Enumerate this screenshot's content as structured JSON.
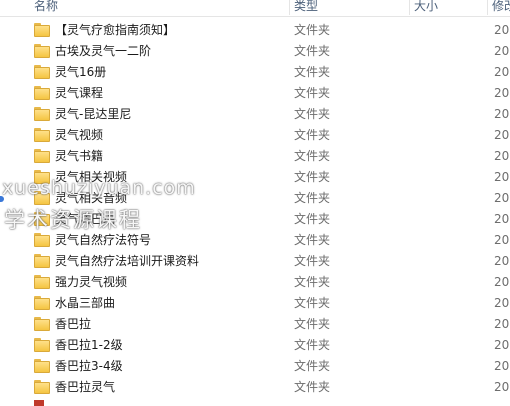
{
  "header": {
    "name": "名称",
    "type": "类型",
    "size": "大小",
    "date": "修改"
  },
  "rows": [
    {
      "name": "【灵气疗愈指南须知】",
      "type": "文件夹",
      "date": "20"
    },
    {
      "name": "古埃及灵气一二阶",
      "type": "文件夹",
      "date": "20"
    },
    {
      "name": "灵气16册",
      "type": "文件夹",
      "date": "20"
    },
    {
      "name": "灵气课程",
      "type": "文件夹",
      "date": "20"
    },
    {
      "name": "灵气-昆达里尼",
      "type": "文件夹",
      "date": "20"
    },
    {
      "name": "灵气视频",
      "type": "文件夹",
      "date": "20"
    },
    {
      "name": "灵气书籍",
      "type": "文件夹",
      "date": "20"
    },
    {
      "name": "灵气相关视频",
      "type": "文件夹",
      "date": "20"
    },
    {
      "name": "灵气相关音频",
      "type": "文件夹",
      "date": "20"
    },
    {
      "name": "灵气清巴瑞",
      "type": "文件夹",
      "date": "20"
    },
    {
      "name": "灵气自然疗法符号",
      "type": "文件夹",
      "date": "20"
    },
    {
      "name": "灵气自然疗法培训开课资料",
      "type": "文件夹",
      "date": "20"
    },
    {
      "name": "强力灵气视频",
      "type": "文件夹",
      "date": "20"
    },
    {
      "name": "水晶三部曲",
      "type": "文件夹",
      "date": "20"
    },
    {
      "name": "香巴拉",
      "type": "文件夹",
      "date": "20"
    },
    {
      "name": "香巴拉1-2级",
      "type": "文件夹",
      "date": "20"
    },
    {
      "name": "香巴拉3-4级",
      "type": "文件夹",
      "date": "20"
    },
    {
      "name": "香巴拉灵气",
      "type": "文件夹",
      "date": "20"
    }
  ],
  "watermark": {
    "url": "xueshuziyuan.com",
    "text": "学术资源课程"
  },
  "icons": {
    "folder": "folder-icon"
  },
  "colors": {
    "folder": "#f5c542",
    "header_text": "#4c607a",
    "secondary_text": "#6d6d6d"
  }
}
